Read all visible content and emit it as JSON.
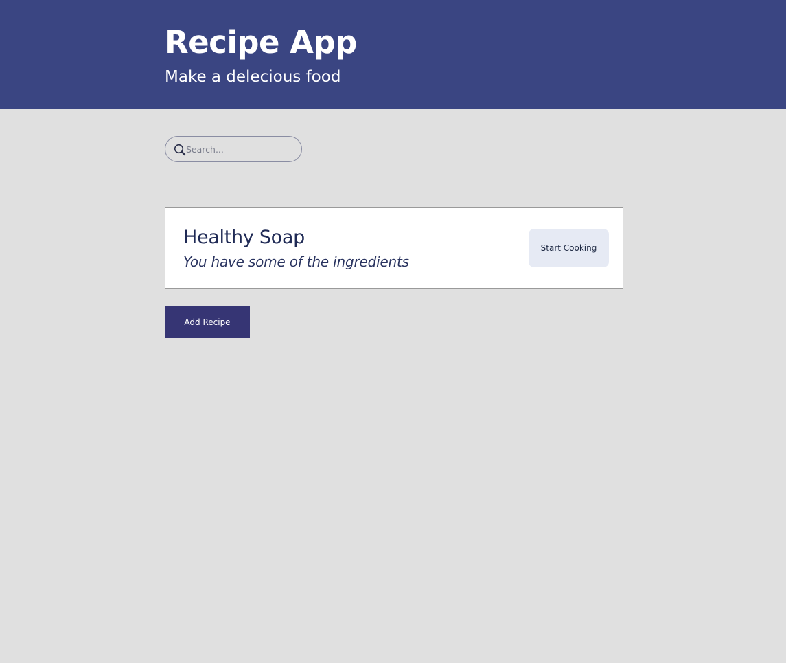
{
  "header": {
    "title": "Recipe App",
    "subtitle": "Make a delecious food"
  },
  "search": {
    "placeholder": "Search...",
    "value": "",
    "icon": "search-icon"
  },
  "recipes": [
    {
      "name": "Healthy Soap",
      "status": "You have some of the ingredients",
      "action_label": "Start Cooking"
    }
  ],
  "actions": {
    "add_recipe_label": "Add Recipe"
  },
  "colors": {
    "header_bg": "#3a4582",
    "page_bg": "#e0e0e0",
    "card_bg": "#ffffff",
    "primary_button": "#363574",
    "secondary_button": "#e6eaf4",
    "text_dark": "#1f2a55"
  }
}
